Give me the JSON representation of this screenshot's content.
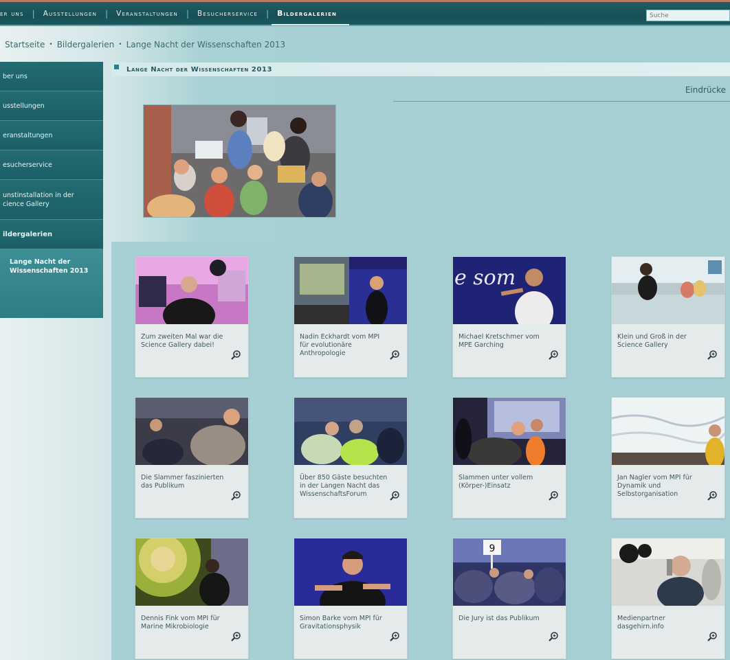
{
  "topnav": {
    "items": [
      {
        "label": "ber uns"
      },
      {
        "label": "Ausstellungen"
      },
      {
        "label": "Veranstaltungen"
      },
      {
        "label": "Besucherservice"
      },
      {
        "label": "Bildergalerien"
      }
    ],
    "search_placeholder": "Suche"
  },
  "breadcrumb": {
    "items": [
      "Startseite",
      "Bildergalerien",
      "Lange Nacht der Wissenschaften 2013"
    ]
  },
  "sidebar": {
    "items": [
      {
        "label": "ber uns"
      },
      {
        "label": "usstellungen"
      },
      {
        "label": "eranstaltungen"
      },
      {
        "label": "esucherservice"
      },
      {
        "label": "unstinstallation in der\ncience Gallery"
      },
      {
        "label": "ildergalerien"
      }
    ],
    "sub_item": "Lange Nacht der Wissenschaften 2013"
  },
  "content": {
    "title": "Lange Nacht der Wissenschaften 2013",
    "section_label": "Eindrücke"
  },
  "gallery": {
    "cards": [
      {
        "caption": "Zum zweiten Mal war die Science Gallery dabei!"
      },
      {
        "caption": "Nadin Eckhardt vom MPI für evolutionäre Anthropologie"
      },
      {
        "caption": "Michael Kretschmer vom MPE Garching"
      },
      {
        "caption": "Klein und Groß in der Science Gallery"
      },
      {
        "caption": "Die Slammer faszinierten das Publikum"
      },
      {
        "caption": "Über 850 Gäste besuchten in der Langen Nacht das WissenschaftsForum"
      },
      {
        "caption": "Slammen unter vollem (Körper-)Einsatz"
      },
      {
        "caption": "Jan Nagler vom MPI für Dynamik und Selbstorganisation"
      },
      {
        "caption": "Dennis Fink vom MPI für Marine Mikrobiologie"
      },
      {
        "caption": "Simon Barke vom MPI für Gravitationsphysik"
      },
      {
        "caption": "Die Jury ist das Publikum"
      },
      {
        "caption": "Medienpartner dasgehirn.info"
      }
    ],
    "thumb_texts": {
      "slogan_fragment": "e som",
      "jury_card": "9"
    }
  },
  "colors": {
    "nav_bg": "#1b585e",
    "sidebar_bg": "#1a6168",
    "sidebar_active_sub": "#3d8f95",
    "page_bg": "#a6d0d4",
    "card_bg": "#e5ebeb",
    "accent_top": "#b97a68"
  },
  "icons": {
    "zoom": "magnifier-plus-icon",
    "title_marker": "square-bullet-icon"
  }
}
